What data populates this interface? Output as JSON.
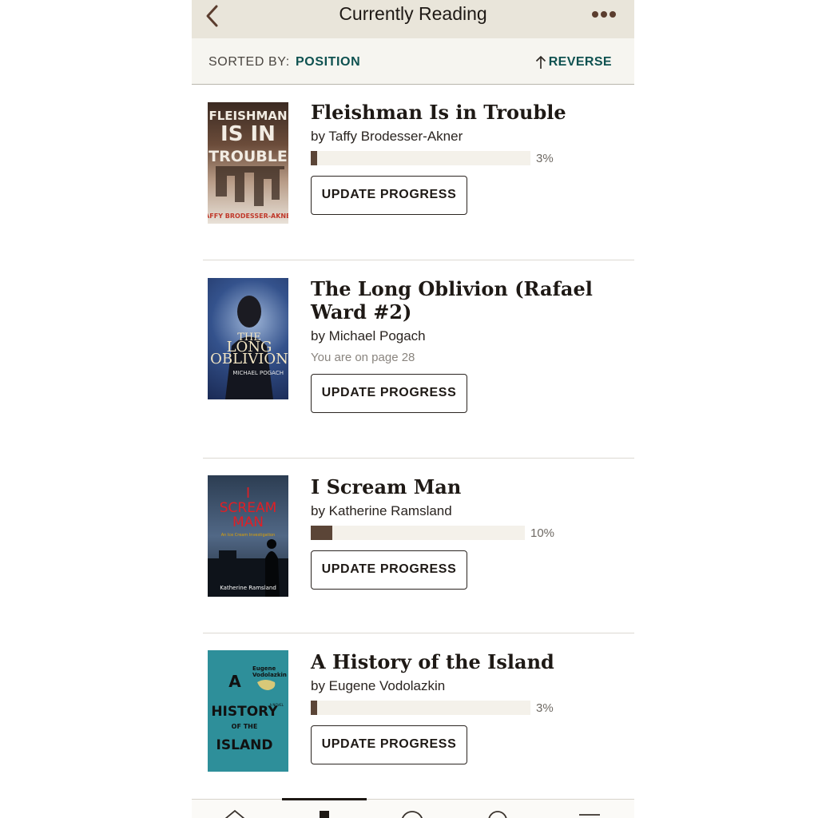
{
  "header": {
    "title": "Currently Reading",
    "back_icon": "chevron-left-icon",
    "more_icon": "ellipsis-icon"
  },
  "sort": {
    "label": "SORTED BY:",
    "value": "POSITION",
    "reverse_label": "REVERSE",
    "reverse_icon": "arrow-up-icon"
  },
  "books": [
    {
      "title": "Fleishman Is in Trouble",
      "author": "by Taffy Brodesser-Akner",
      "progress_text": "3%",
      "progress": 0.03,
      "button": "UPDATE PROGRESS",
      "cover": {
        "title_lines": [
          "FLEISHMAN",
          "IS IN",
          "TROUBLE"
        ],
        "author": "TAFFY BRODESSER-AKNER"
      }
    },
    {
      "title": "The Long Oblivion (Rafael Ward #2)",
      "author": "by Michael Pogach",
      "page_note": "You are on page 28",
      "button": "UPDATE PROGRESS",
      "cover": {
        "title_lines": [
          "THE",
          "LONG",
          "OBLIVION"
        ],
        "author": "MICHAEL POGACH"
      }
    },
    {
      "title": "I Scream Man",
      "author": "by Katherine Ramsland",
      "progress_text": "10%",
      "progress": 0.1,
      "button": "UPDATE PROGRESS",
      "cover": {
        "title_lines": [
          "I",
          "SCREAM",
          "MAN"
        ],
        "subtitle": "An Ice Cream Investigation",
        "author": "Katherine Ramsland"
      }
    },
    {
      "title": "A History of the Island",
      "author": "by Eugene Vodolazkin",
      "progress_text": "3%",
      "progress": 0.03,
      "button": "UPDATE PROGRESS",
      "cover": {
        "title_lines": [
          "A",
          "HISTORY",
          "OF THE",
          "ISLAND"
        ],
        "author_first": "Eugene",
        "author_last": "Vodolazkin",
        "tag": "A NOVEL"
      }
    }
  ],
  "colors": {
    "header_bg": "#e9e5da",
    "accent": "#0e5150",
    "progress_fill": "#5b4537",
    "progress_track": "#f4f1ea"
  },
  "bottom_nav": {
    "icons": [
      "home-icon",
      "my-books-icon",
      "discover-icon",
      "search-icon",
      "menu-icon"
    ]
  }
}
